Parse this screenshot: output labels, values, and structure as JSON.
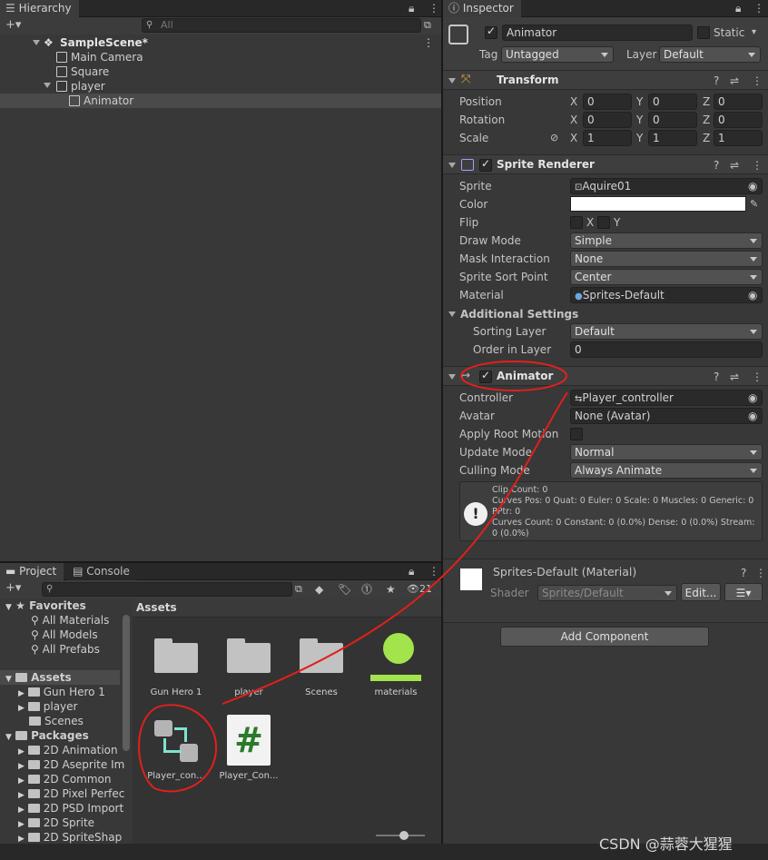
{
  "hierarchy": {
    "tab_label": "Hierarchy",
    "search_placeholder": "All",
    "add_label": "+▾",
    "scene_name": "SampleScene*",
    "items": [
      {
        "label": "Main Camera"
      },
      {
        "label": "Square"
      },
      {
        "label": "player"
      },
      {
        "label": "Animator"
      }
    ]
  },
  "inspector": {
    "tab_label": "Inspector",
    "object_name": "Animator",
    "static_label": "Static",
    "tag_label": "Tag",
    "tag_value": "Untagged",
    "layer_label": "Layer",
    "layer_value": "Default",
    "transform": {
      "title": "Transform",
      "position_label": "Position",
      "rotation_label": "Rotation",
      "scale_label": "Scale",
      "position": {
        "x": "0",
        "y": "0",
        "z": "0"
      },
      "rotation": {
        "x": "0",
        "y": "0",
        "z": "0"
      },
      "scale": {
        "x": "1",
        "y": "1",
        "z": "1"
      },
      "axis_x": "X",
      "axis_y": "Y",
      "axis_z": "Z"
    },
    "sprite_renderer": {
      "title": "Sprite Renderer",
      "sprite_label": "Sprite",
      "sprite_value": "Aquire01",
      "color_label": "Color",
      "flip_label": "Flip",
      "flip_x": "X",
      "flip_y": "Y",
      "draw_mode_label": "Draw Mode",
      "draw_mode_value": "Simple",
      "mask_label": "Mask Interaction",
      "mask_value": "None",
      "sort_point_label": "Sprite Sort Point",
      "sort_point_value": "Center",
      "material_label": "Material",
      "material_value": "Sprites-Default",
      "additional_label": "Additional Settings",
      "sorting_layer_label": "Sorting Layer",
      "sorting_layer_value": "Default",
      "order_label": "Order in Layer",
      "order_value": "0"
    },
    "animator": {
      "title": "Animator",
      "controller_label": "Controller",
      "controller_value": "Player_controller",
      "avatar_label": "Avatar",
      "avatar_value": "None (Avatar)",
      "root_motion_label": "Apply Root Motion",
      "update_mode_label": "Update Mode",
      "update_mode_value": "Normal",
      "culling_label": "Culling Mode",
      "culling_value": "Always Animate",
      "info_lines": [
        "Clip Count: 0",
        "Curves Pos: 0 Quat: 0 Euler: 0 Scale: 0 Muscles: 0 Generic: 0",
        "PPtr: 0",
        "Curves Count: 0 Constant: 0 (0.0%) Dense: 0 (0.0%) Stream:",
        "0 (0.0%)"
      ]
    },
    "material": {
      "title": "Sprites-Default (Material)",
      "shader_label": "Shader",
      "shader_value": "Sprites/Default",
      "edit_label": "Edit...",
      "menu_label": "☰▾"
    },
    "add_component_label": "Add Component"
  },
  "project": {
    "tab_project": "Project",
    "tab_console": "Console",
    "hidden_count": "21",
    "favorites_label": "Favorites",
    "favorites": [
      "All Materials",
      "All Models",
      "All Prefabs"
    ],
    "assets_label": "Assets",
    "assets_tree": [
      "Gun Hero 1",
      "player",
      "Scenes"
    ],
    "packages_label": "Packages",
    "packages": [
      "2D Animation",
      "2D Aseprite Im",
      "2D Common",
      "2D Pixel Perfec",
      "2D PSD Import",
      "2D Sprite",
      "2D SpriteShap"
    ],
    "breadcrumb": "Assets",
    "grid_items": [
      {
        "label": "Gun Hero 1"
      },
      {
        "label": "player"
      },
      {
        "label": "Scenes"
      },
      {
        "label": "materials"
      },
      {
        "label": "Player_con..."
      },
      {
        "label": "Player_Con..."
      }
    ]
  },
  "watermark": "CSDN @蒜蓉大猩猩",
  "colors": {
    "annotation_red": "#e0201c",
    "materials_green": "#a3e44c",
    "controller_teal": "#7fe3d0",
    "script_green": "#2c7a2c"
  }
}
